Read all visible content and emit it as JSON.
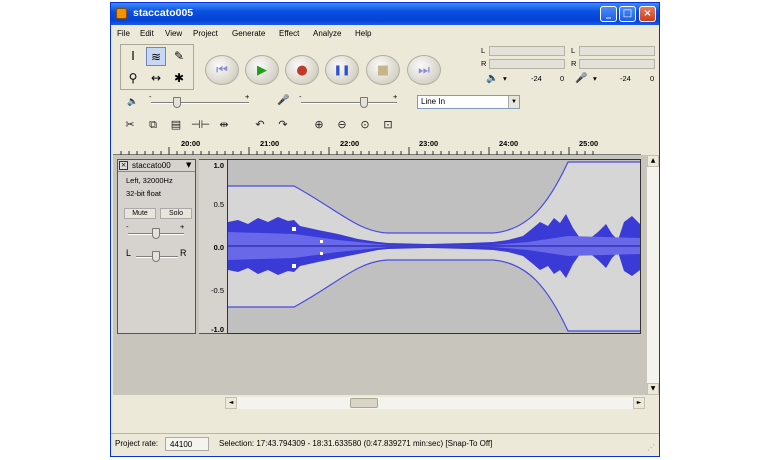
{
  "window": {
    "title": "staccato005"
  },
  "menu": [
    "File",
    "Edit",
    "View",
    "Project",
    "Generate",
    "Effect",
    "Analyze",
    "Help"
  ],
  "title_buttons": {
    "minimize": "_",
    "maximize": "□",
    "close": "×"
  },
  "tools": [
    {
      "name": "selection-tool-icon",
      "glyph": "I"
    },
    {
      "name": "envelope-tool-icon",
      "glyph": "≋"
    },
    {
      "name": "draw-tool-icon",
      "glyph": "✎"
    },
    {
      "name": "zoom-tool-icon",
      "glyph": "⚲"
    },
    {
      "name": "timeshift-tool-icon",
      "glyph": "↔"
    },
    {
      "name": "multi-tool-icon",
      "glyph": "✱"
    }
  ],
  "transport": [
    {
      "name": "skip-start-button",
      "glyph": "⏮",
      "color": "#8a8ad8"
    },
    {
      "name": "play-button",
      "glyph": "▶",
      "color": "#1f9e1f"
    },
    {
      "name": "record-button",
      "glyph": "●",
      "color": "#c0392b"
    },
    {
      "name": "pause-button",
      "glyph": "❚❚",
      "color": "#3050d0"
    },
    {
      "name": "stop-button",
      "glyph": "■",
      "color": "#c8b48a"
    },
    {
      "name": "skip-end-button",
      "glyph": "⏭",
      "color": "#8a8ad8"
    }
  ],
  "meters": {
    "l": "L",
    "r": "R",
    "play_scale": [
      "-24",
      "0"
    ],
    "rec_scale": [
      "-24",
      "0"
    ]
  },
  "mixer": {
    "input_source": "Line In",
    "dropdown_glyph": "▼",
    "slider_min": "-",
    "slider_max": "+"
  },
  "edit_tools": [
    "✂",
    "⧉",
    "▤",
    "⊣⊢",
    "⇹",
    "↶",
    "↷",
    "⊕",
    "⊖",
    "⊙",
    "⊡"
  ],
  "ruler": [
    "20:00",
    "21:00",
    "22:00",
    "23:00",
    "24:00",
    "25:00"
  ],
  "track": {
    "close_glyph": "×",
    "name": "staccato00",
    "menu_glyph": "▼",
    "info1": "Left, 32000Hz",
    "info2": "32-bit float",
    "mute": "Mute",
    "solo": "Solo",
    "gain_minus": "-",
    "gain_plus": "+",
    "pan_l": "L",
    "pan_r": "R",
    "vruler": [
      "1.0",
      "0.5",
      "0.0",
      "-0.5",
      "-1.0"
    ]
  },
  "scroll": {
    "up": "▲",
    "down": "▼",
    "left": "◄",
    "right": "►"
  },
  "status": {
    "rate_label": "Project rate:",
    "rate_value": "44100",
    "selection": "Selection: 17:43.794309 - 18:31.633580 (0:47.839271 min:sec)  [Snap-To Off]"
  }
}
